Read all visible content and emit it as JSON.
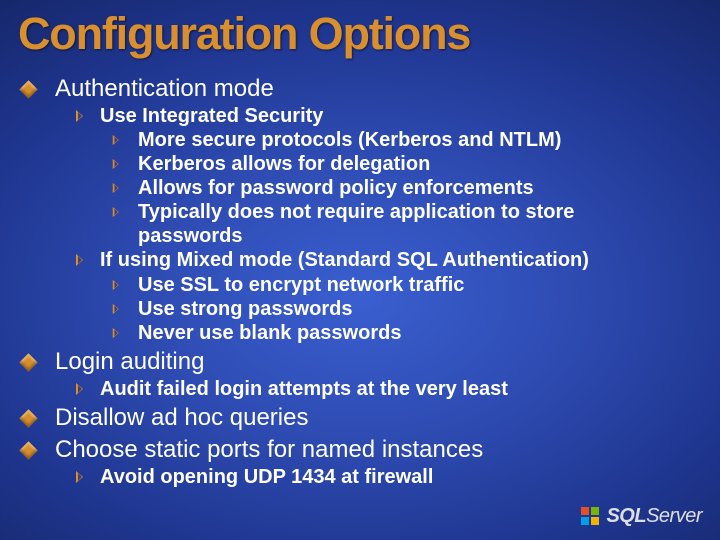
{
  "title": "Configuration Options",
  "bullets": [
    {
      "label": "Authentication mode",
      "children": [
        {
          "label": "Use Integrated Security",
          "children": [
            {
              "label": "More secure protocols (Kerberos and NTLM)"
            },
            {
              "label": "Kerberos allows for delegation"
            },
            {
              "label": "Allows for password policy enforcements"
            },
            {
              "label": "Typically does not require application to store passwords"
            }
          ]
        },
        {
          "label": "If using Mixed mode (Standard SQL Authentication)",
          "children": [
            {
              "label": "Use SSL to encrypt network traffic"
            },
            {
              "label": "Use strong passwords"
            },
            {
              "label": "Never use blank passwords"
            }
          ]
        }
      ]
    },
    {
      "label": "Login auditing",
      "children": [
        {
          "label": "Audit failed login attempts at the very least"
        }
      ]
    },
    {
      "label": "Disallow ad hoc queries"
    },
    {
      "label": "Choose static ports for named instances",
      "children": [
        {
          "label": "Avoid opening UDP 1434 at firewall"
        }
      ]
    }
  ],
  "logo": {
    "brand1": "SQL",
    "brand2": "Server"
  }
}
